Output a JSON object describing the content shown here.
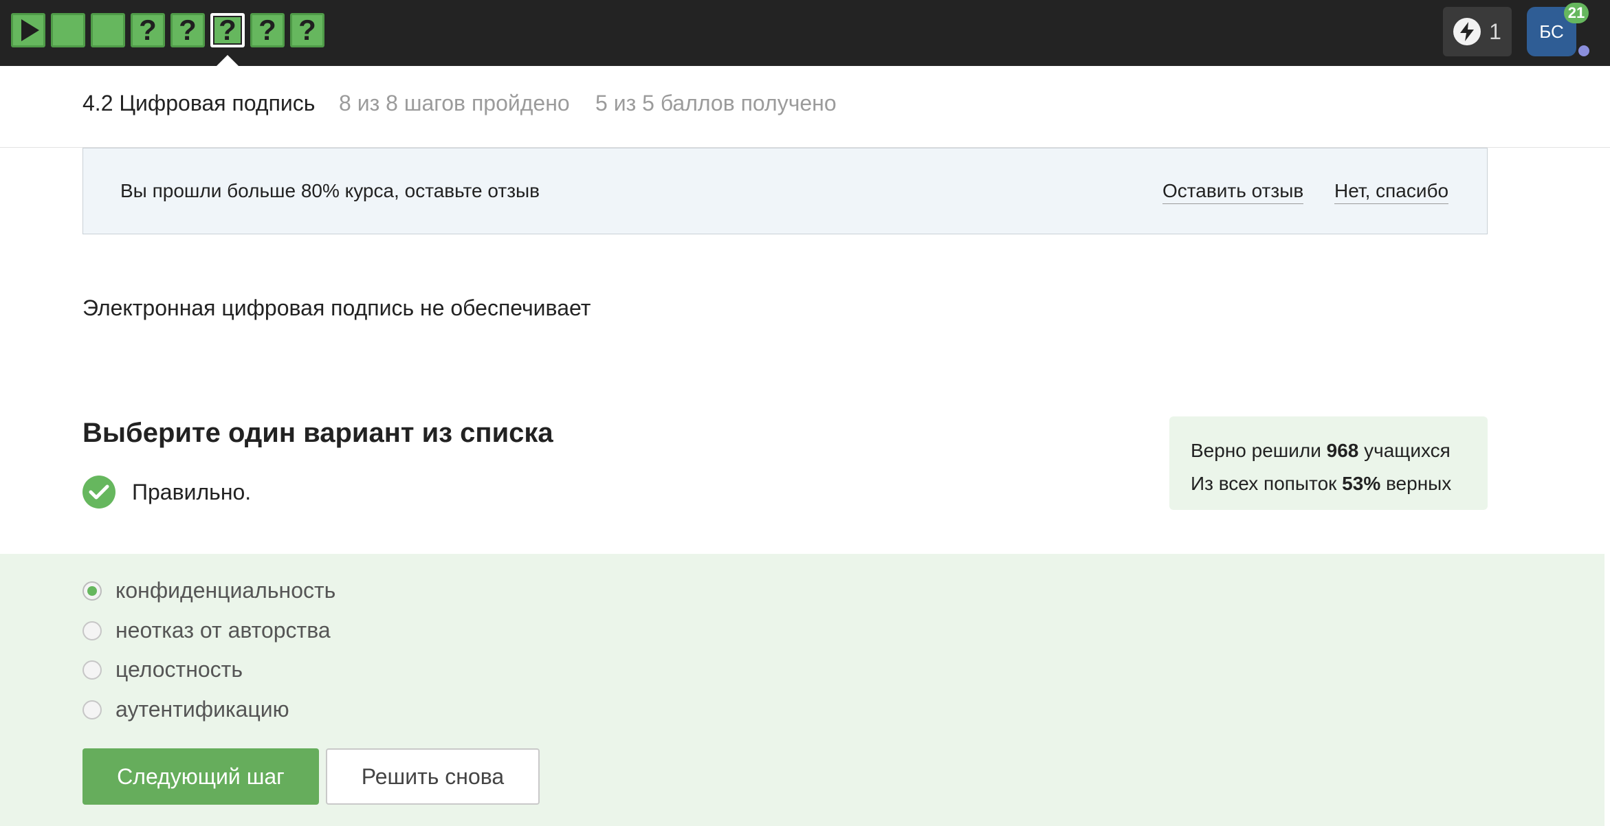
{
  "topbar": {
    "steps": [
      {
        "type": "play",
        "icon": "play-icon",
        "glyph": ""
      },
      {
        "type": "done",
        "icon": "",
        "glyph": ""
      },
      {
        "type": "done",
        "icon": "",
        "glyph": ""
      },
      {
        "type": "quiz",
        "icon": "question-icon",
        "glyph": "?"
      },
      {
        "type": "quiz",
        "icon": "question-icon",
        "glyph": "?"
      },
      {
        "type": "quiz-active",
        "icon": "question-icon",
        "glyph": "?"
      },
      {
        "type": "quiz",
        "icon": "question-icon",
        "glyph": "?"
      },
      {
        "type": "quiz",
        "icon": "question-icon",
        "glyph": "?"
      }
    ],
    "energy_count": "1",
    "avatar_initials": "БС",
    "avatar_badge": "21"
  },
  "lesson": {
    "title": "4.2 Цифровая подпись",
    "progress": "8 из 8 шагов пройдено",
    "points": "5 из 5 баллов  получено"
  },
  "banner": {
    "text": "Вы прошли больше 80% курса, оставьте отзыв",
    "leave_review": "Оставить отзыв",
    "no_thanks": "Нет, спасибо"
  },
  "question": {
    "text": "Электронная цифровая подпись не обеспечивает",
    "heading": "Выберите один вариант из списка",
    "result": "Правильно."
  },
  "stats": {
    "solved_prefix": "Верно решили ",
    "solved_count": "968",
    "solved_suffix": " учащихся",
    "attempts_prefix": "Из всех попыток ",
    "attempts_percent": "53%",
    "attempts_suffix": " верных"
  },
  "options": [
    {
      "label": "конфиденциальность",
      "selected": true
    },
    {
      "label": "неотказ от авторства",
      "selected": false
    },
    {
      "label": "целостность",
      "selected": false
    },
    {
      "label": "аутентификацию",
      "selected": false
    }
  ],
  "buttons": {
    "next": "Следующий шаг",
    "retry": "Решить снова"
  },
  "colors": {
    "accent_green": "#66b75e",
    "topbar_bg": "#232323",
    "answer_bg": "#ebf5ea",
    "avatar_bg": "#2f5d95"
  }
}
